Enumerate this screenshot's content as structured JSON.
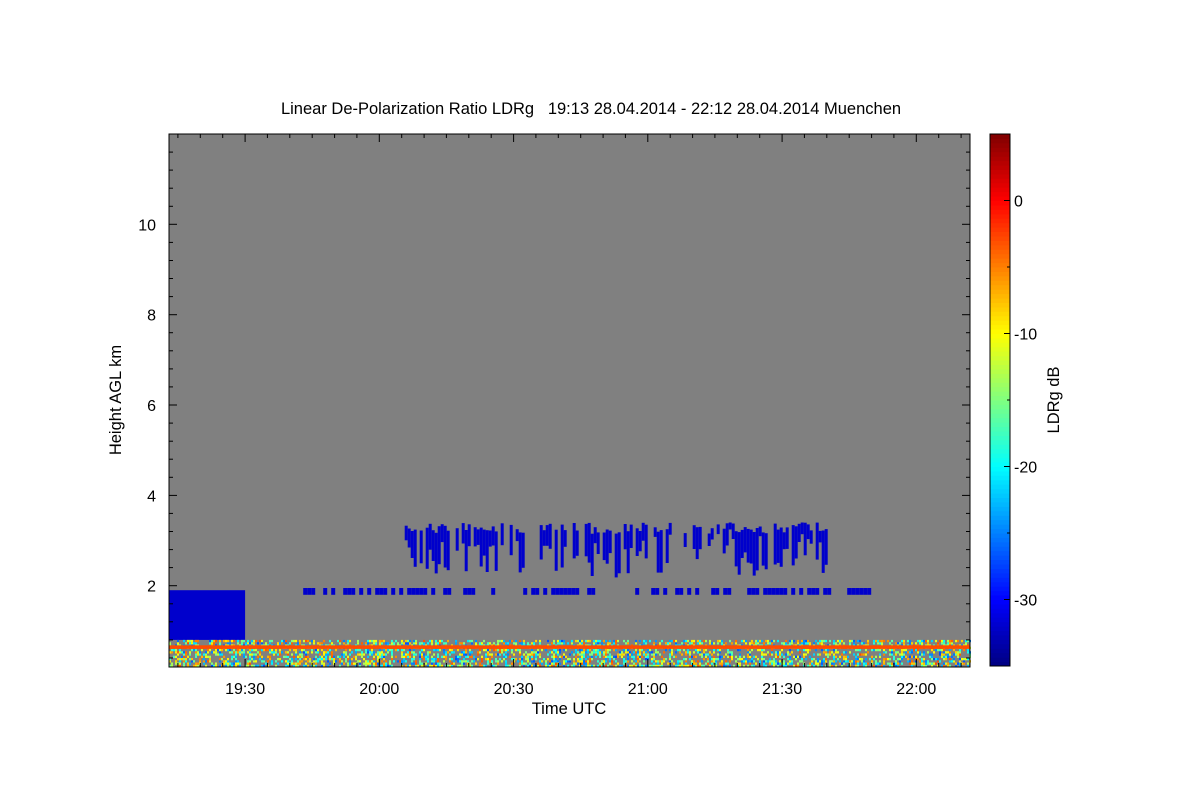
{
  "chart_data": {
    "type": "heatmap",
    "title": "Linear De-Polarization Ratio LDRg   19:13 28.04.2014 - 22:12 28.04.2014 Muenchen",
    "xlabel": "Time UTC",
    "ylabel": "Height AGL km",
    "colorbar_label": "LDRg dB",
    "x_start": "19:13",
    "x_end": "22:12",
    "x_ticks": [
      "19:30",
      "20:00",
      "20:30",
      "21:00",
      "21:30",
      "22:00"
    ],
    "y_ticks": [
      "2",
      "4",
      "6",
      "8",
      "10"
    ],
    "ylim": [
      0.2,
      12.0
    ],
    "colorbar_ticks": [
      "0",
      "-10",
      "-20",
      "-30"
    ],
    "colorbar_range": [
      -35,
      5
    ],
    "colorscale": "jet",
    "background_color": "#808080",
    "features": [
      {
        "feature": "low cloud layer",
        "time_start": "19:13",
        "time_end": "19:30",
        "height_min": 0.8,
        "height_max": 1.9,
        "ldr": -32
      },
      {
        "feature": "mid-level cloud",
        "time_start": "20:05",
        "time_end": "21:40",
        "height_min": 2.3,
        "height_max": 3.4,
        "ldr": -32
      },
      {
        "feature": "thin layer",
        "time_start": "19:43",
        "time_end": "21:50",
        "height_min": 1.8,
        "height_max": 1.95,
        "ldr": -32
      },
      {
        "feature": "near-surface clutter",
        "time_start": "19:13",
        "time_end": "22:12",
        "height_min": 0.2,
        "height_max": 0.8,
        "ldr": -15
      },
      {
        "feature": "surface line",
        "time_start": "19:13",
        "time_end": "22:12",
        "height_min": 0.6,
        "height_max": 0.68,
        "ldr": -3
      }
    ]
  }
}
